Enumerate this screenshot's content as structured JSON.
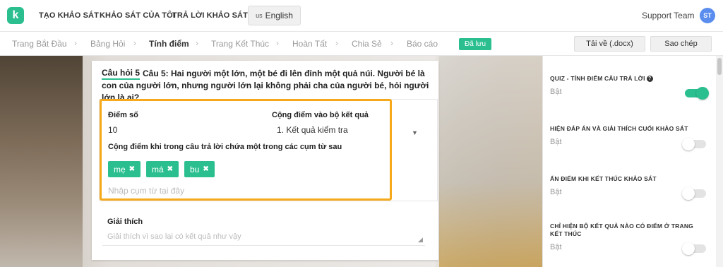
{
  "brand": {
    "logo_letter": "k",
    "accent": "#2bbf8f"
  },
  "topnav": {
    "items": [
      "TẠO KHẢO SÁT",
      "KHẢO SÁT CỦA TÔI",
      "TRẢ LỜI KHẢO SÁT"
    ],
    "language": {
      "flag": "us",
      "label": "English"
    },
    "user": {
      "name": "Support Team",
      "initials": "ST"
    }
  },
  "steps": {
    "items": [
      "Trang Bắt Đầu",
      "Bảng Hỏi",
      "Tính điểm",
      "Trang Kết Thúc",
      "Hoàn Tất",
      "Chia Sẻ",
      "Báo cáo"
    ],
    "active": "Tính điểm",
    "saved_badge": "Đã lưu",
    "download_label": "Tải về (.docx)",
    "copy_label": "Sao chép"
  },
  "question": {
    "label": "Câu hỏi 5",
    "text": "Câu 5: Hai người một lớn, một bé đi lên đỉnh một quả núi. Người bé là con của người lớn, nhưng người lớn lại không phải cha của người bé, hỏi người lớn là ai?",
    "score_label": "Điểm số",
    "score_value": "10",
    "add_to_result_label": "Cộng điểm vào bộ kết quả",
    "add_to_result_value": "1. Kết quả kiểm tra",
    "phrase_rule_label": "Cộng điểm khi trong câu trả lời chứa một trong các cụm từ sau",
    "tags": [
      "mẹ",
      "má",
      "bu"
    ],
    "phrase_placeholder": "Nhập cụm từ tại đây",
    "explain_label": "Giải thích",
    "explain_placeholder": "Giải thích vì sao lại có kết quả như vậy"
  },
  "settings": [
    {
      "title": "QUIZ - TÍNH ĐIỂM CÂU TRẢ LỜI",
      "status": "Bật",
      "on": true
    },
    {
      "title": "HIỆN ĐÁP ÁN VÀ GIẢI THÍCH CUỐI KHẢO SÁT",
      "status": "Bật",
      "on": false
    },
    {
      "title": "ẨN ĐIỂM KHI KẾT THÚC KHẢO SÁT",
      "status": "Bật",
      "on": false
    },
    {
      "title": "CHỈ HIỆN BỘ KẾT QUẢ NÀO CÓ ĐIỂM Ở TRANG KẾT THÚC",
      "status": "Bật",
      "on": false
    }
  ]
}
